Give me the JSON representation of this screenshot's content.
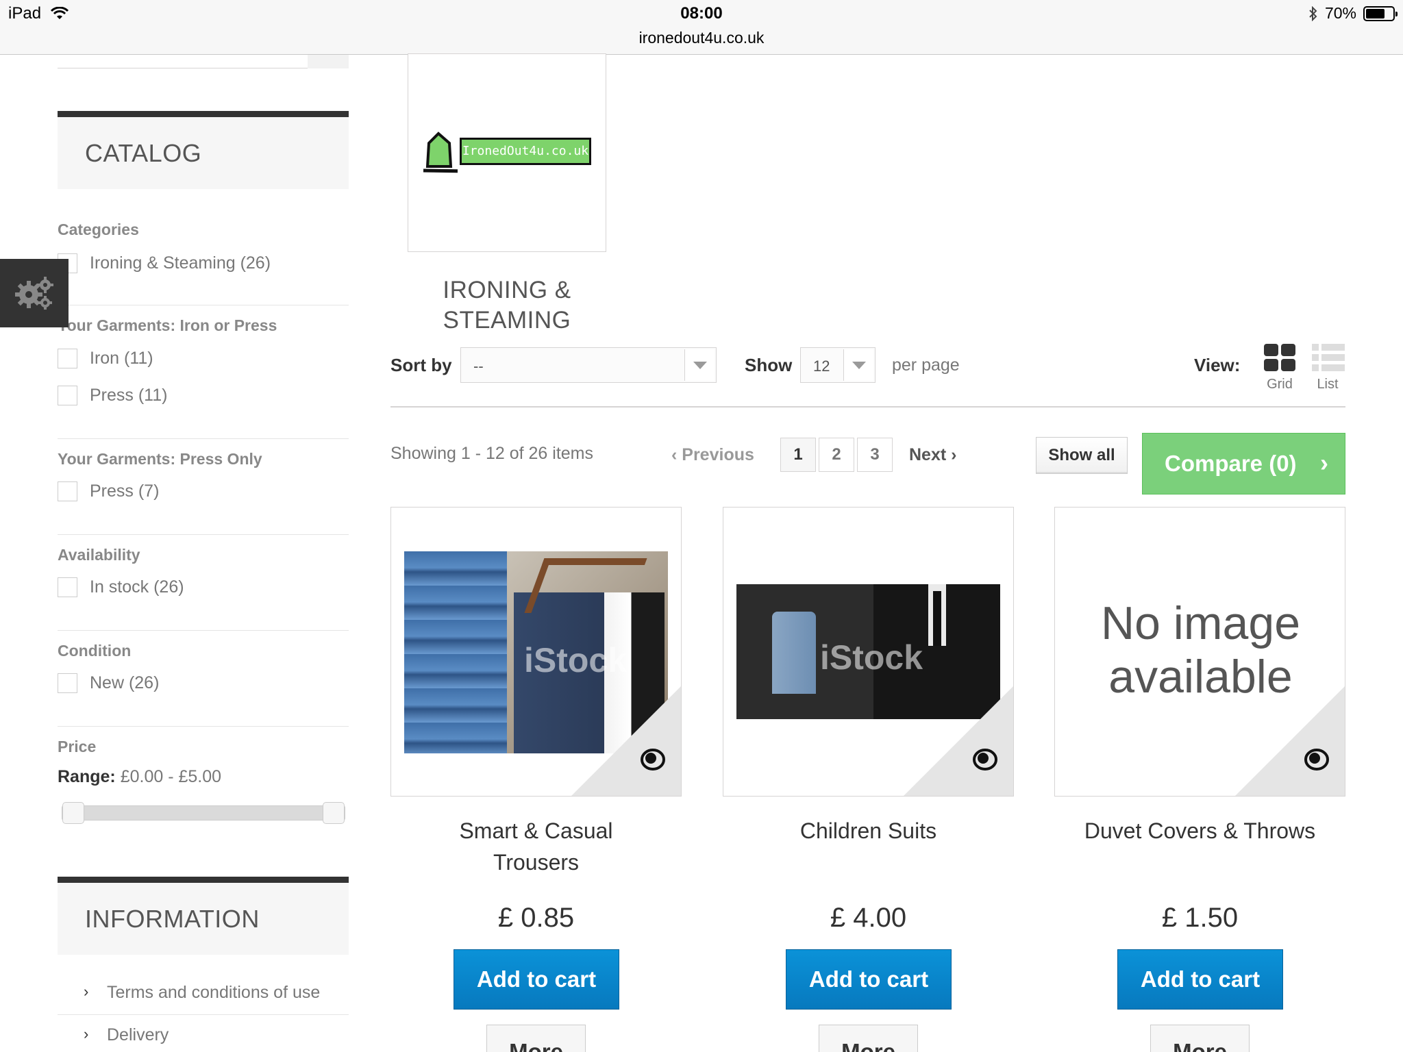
{
  "statusbar": {
    "device": "iPad",
    "time": "08:00",
    "url": "ironedout4u.co.uk",
    "battery": "70%",
    "battery_level": 0.7
  },
  "catalog": {
    "title": "CATALOG",
    "filters": [
      {
        "heading": "Categories",
        "items": [
          "Ironing & Steaming (26)"
        ]
      },
      {
        "heading": "Your Garments: Iron or Press",
        "items": [
          "Iron (11)",
          "Press (11)"
        ]
      },
      {
        "heading": "Your Garments: Press Only",
        "items": [
          "Press (7)"
        ]
      },
      {
        "heading": "Availability",
        "items": [
          "In stock (26)"
        ]
      },
      {
        "heading": "Condition",
        "items": [
          "New (26)"
        ]
      }
    ],
    "price": {
      "heading": "Price",
      "range_label": "Range:",
      "range_value": "£0.00 - £5.00",
      "min": 0,
      "max": 5,
      "selected_min": 0,
      "selected_max": 5
    }
  },
  "information": {
    "title": "INFORMATION",
    "links": [
      "Terms and conditions of use",
      "Delivery"
    ]
  },
  "category": {
    "logo_text": "IronedOut4u.co.uk",
    "name_line1": "IRONING &",
    "name_line2": "STEAMING"
  },
  "sortbar": {
    "sort_label": "Sort by",
    "sort_value": "--",
    "show_label": "Show",
    "show_value": "12",
    "per_page": "per page",
    "view_label": "View:",
    "grid_label": "Grid",
    "list_label": "List"
  },
  "pagination": {
    "showing": "Showing 1 - 12 of 26 items",
    "previous": "Previous",
    "pages": [
      "1",
      "2",
      "3"
    ],
    "active_page": "1",
    "next": "Next",
    "show_all": "Show all",
    "compare": "Compare (0)"
  },
  "products": [
    {
      "name_line1": "Smart & Casual",
      "name_line2": "Trousers",
      "price": "£ 0.85",
      "watermark": "iStock"
    },
    {
      "name_line1": "Children Suits",
      "name_line2": "",
      "price": "£ 4.00",
      "watermark": "iStock"
    },
    {
      "name_line1": "Duvet Covers & Throws",
      "name_line2": "",
      "price": "£ 1.50",
      "no_image_line1": "No image",
      "no_image_line2": "available"
    }
  ],
  "buttons": {
    "add_to_cart": "Add to cart",
    "more": "More"
  },
  "colors": {
    "accent_blue": "#0779be",
    "compare_green": "#7bd07b",
    "dark_bar": "#333333"
  }
}
